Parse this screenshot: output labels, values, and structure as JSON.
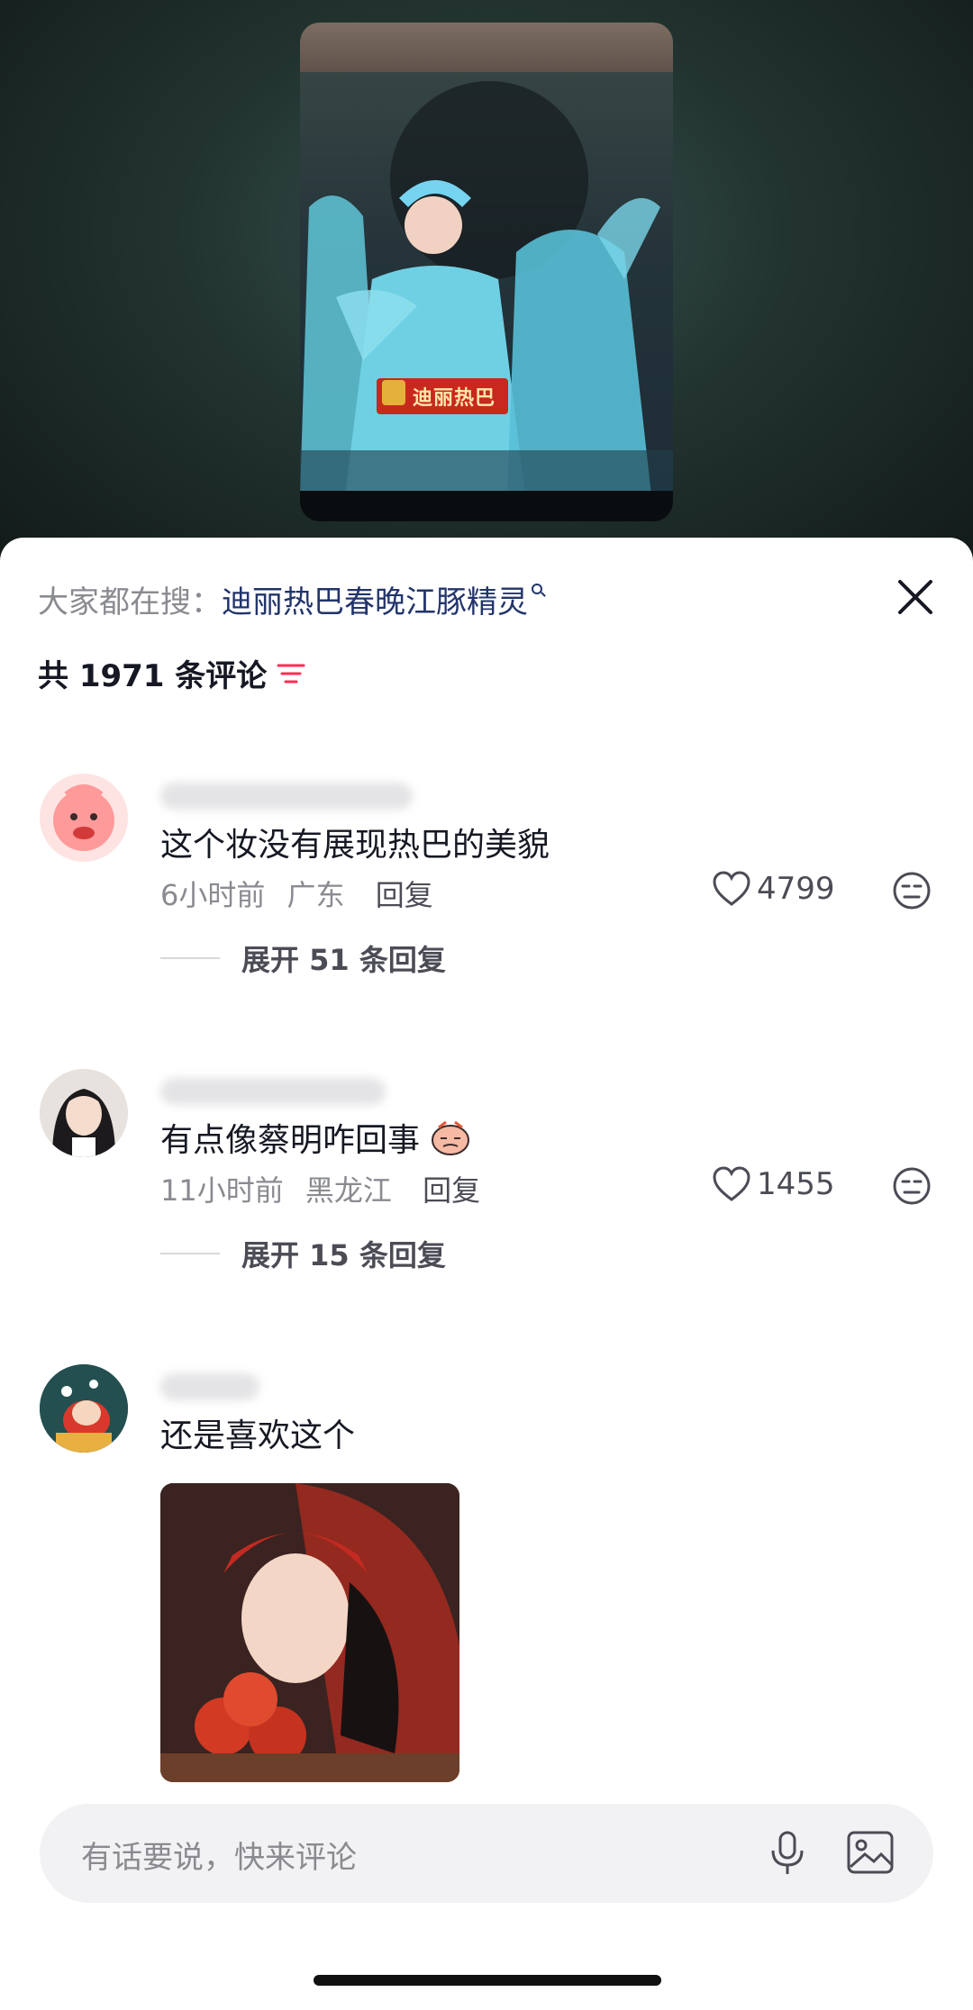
{
  "video": {
    "caption": "迪丽热巴"
  },
  "search": {
    "prefix": "大家都在搜：",
    "term": "迪丽热巴春晚江豚精灵"
  },
  "comments_header": {
    "count_text": "共 1971 条评论"
  },
  "comments": [
    {
      "text": "这个妆没有展现热巴的美貌",
      "time": "6小时前",
      "location": "广东",
      "reply_label": "回复",
      "likes": "4799",
      "expand_label": "展开 51 条回复"
    },
    {
      "text": "有点像蔡明咋回事",
      "time": "11小时前",
      "location": "黑龙江",
      "reply_label": "回复",
      "likes": "1455",
      "expand_label": "展开 15 条回复"
    },
    {
      "text": "还是喜欢这个"
    }
  ],
  "input": {
    "placeholder": "有话要说，快来评论"
  },
  "colors": {
    "accent_red": "#fe2c55",
    "search_term": "#22346b",
    "secondary_text": "#8a8b91"
  }
}
